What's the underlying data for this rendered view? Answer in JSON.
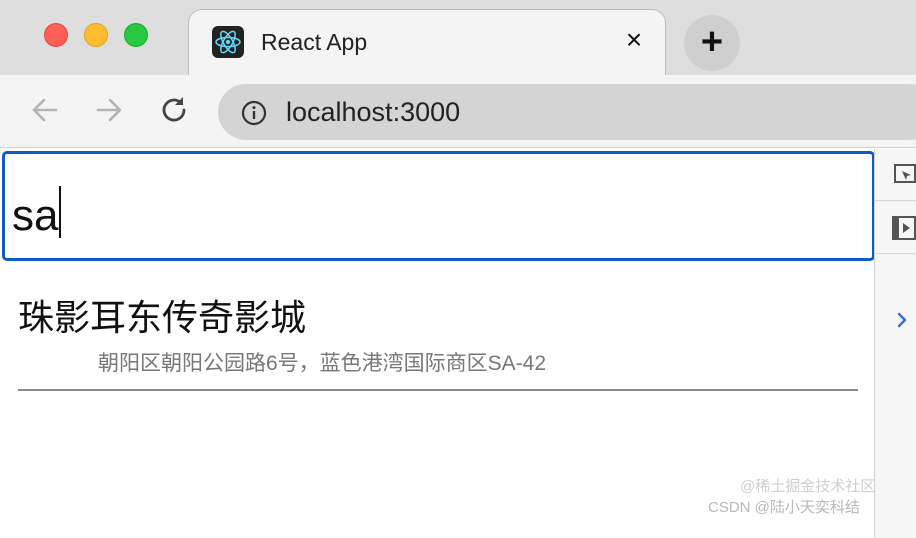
{
  "browser": {
    "tab": {
      "title": "React App",
      "close_glyph": "×"
    },
    "new_tab_glyph": "+",
    "address_bar": {
      "url": "localhost:3000"
    }
  },
  "page": {
    "search": {
      "value": "sa"
    },
    "results": [
      {
        "name": "珠影耳东传奇影城",
        "address": "朝阳区朝阳公园路6号，蓝色港湾国际商区SA-42"
      }
    ]
  },
  "watermark": {
    "line1": "@稀土掘金技术社区",
    "line2": "CSDN @陆小天奕科结"
  },
  "colors": {
    "focus_border": "#0f5cc9",
    "traffic_red": "#fe5f57",
    "traffic_yellow": "#febc2e",
    "traffic_green": "#28c840"
  }
}
